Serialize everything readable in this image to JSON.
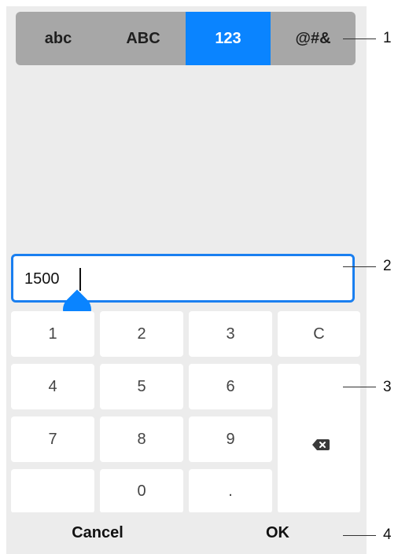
{
  "mode_tabs": [
    {
      "label": "abc"
    },
    {
      "label": "ABC"
    },
    {
      "label": "123"
    },
    {
      "label": "@#&"
    }
  ],
  "active_mode": "123",
  "input": {
    "value": "1500"
  },
  "keypad": {
    "rows": [
      [
        "1",
        "2",
        "3",
        "C"
      ],
      [
        "4",
        "5",
        "6"
      ],
      [
        "7",
        "8",
        "9"
      ],
      [
        "",
        "0",
        "."
      ]
    ],
    "backspace_icon": "backspace-icon"
  },
  "footer": {
    "cancel_label": "Cancel",
    "ok_label": "OK"
  },
  "callouts": [
    "1",
    "2",
    "3",
    "4"
  ],
  "colors": {
    "accent": "#0a84ff",
    "tab_bar": "#a7a7a7",
    "panel_bg": "#ececec",
    "key_bg": "#ffffff",
    "text": "#111111"
  }
}
